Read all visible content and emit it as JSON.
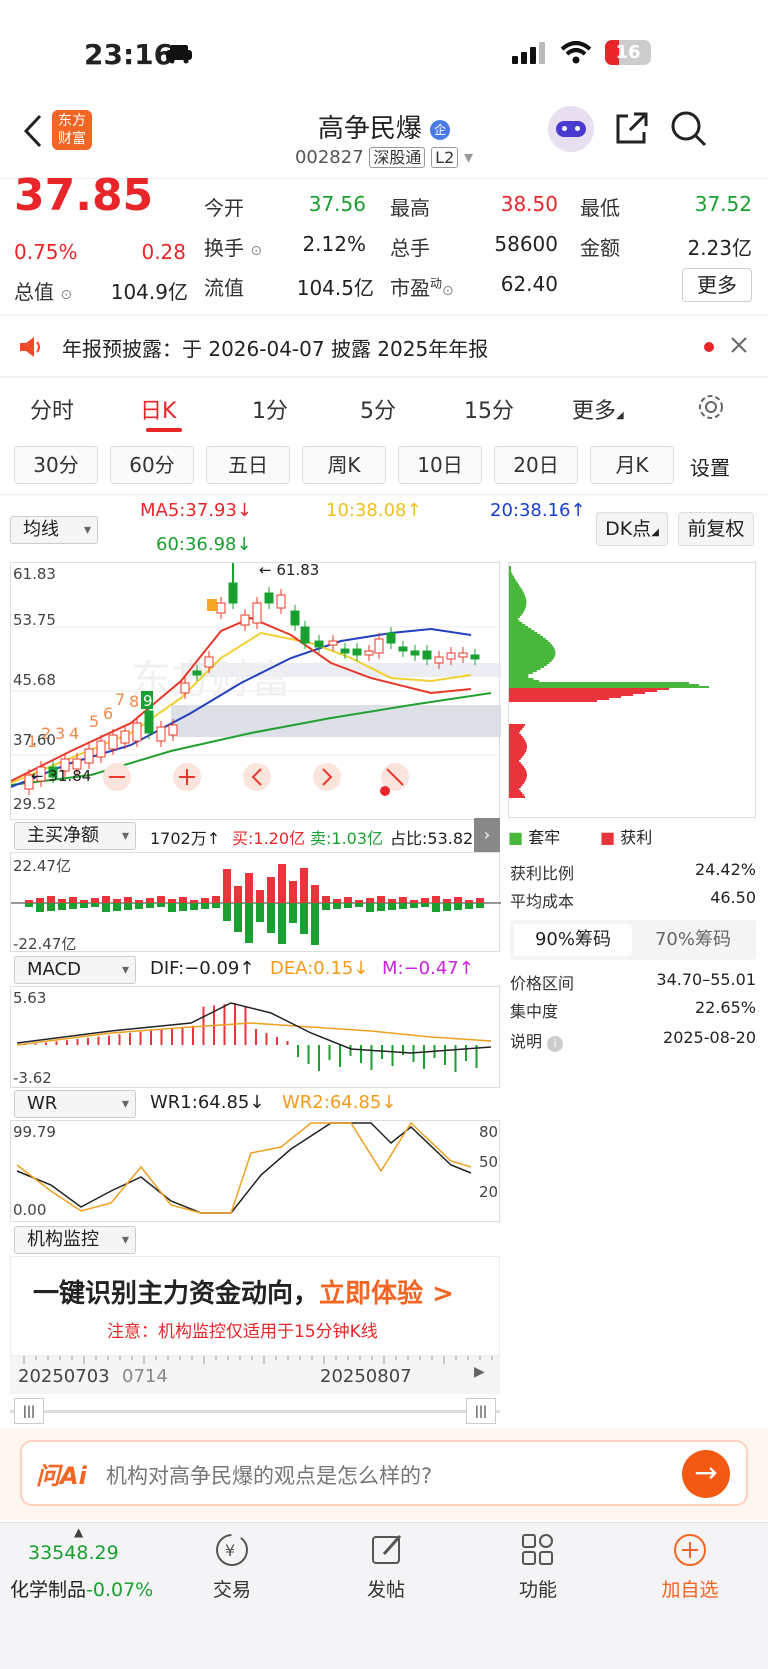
{
  "status": {
    "time": "23:16",
    "battery": "16"
  },
  "header": {
    "title": "高争民爆",
    "code": "002827",
    "tag1": "深股通",
    "tag2": "L2",
    "logo_l1": "东方",
    "logo_l2": "财富"
  },
  "quote": {
    "price": "37.85",
    "change_pct": "0.75%",
    "change": "0.28",
    "open_label": "今开",
    "open": "37.56",
    "high_label": "最高",
    "high": "38.50",
    "low_label": "最低",
    "low": "37.52",
    "turnover_label": "换手",
    "turnover": "2.12%",
    "volume_label": "总手",
    "volume": "58600",
    "amount_label": "金额",
    "amount": "2.23亿",
    "mktcap_label": "总值",
    "mktcap": "104.9亿",
    "float_label": "流值",
    "float": "104.5亿",
    "pe_label": "市盈",
    "pe_sup": "动",
    "pe": "62.40",
    "more_label": "更多"
  },
  "notice": {
    "text": "年报预披露：于 2026-04-07 披露 2025年年报"
  },
  "tabs": [
    "分时",
    "日K",
    "1分",
    "5分",
    "15分",
    "更多"
  ],
  "periods": [
    "30分",
    "60分",
    "五日",
    "周K",
    "10日",
    "20日",
    "月K"
  ],
  "periods_setting": "设置",
  "ma": {
    "selector": "均线",
    "ma5": "MA5:37.93↓",
    "ma10": "10:38.08↑",
    "ma20": "20:38.16↑",
    "ma60": "60:36.98↓",
    "dk": "DK点",
    "adj": "前复权"
  },
  "kchart": {
    "ticks": [
      "61.83",
      "53.75",
      "45.68",
      "37.60",
      "29.52"
    ],
    "high_mark": "61.83",
    "low_mark": "31.84",
    "numbers": [
      "1",
      "2",
      "3",
      "4",
      "5",
      "6",
      "7",
      "8",
      "9"
    ]
  },
  "chip": {
    "legend_hold": "套牢",
    "legend_profit": "获利",
    "colors": {
      "hold": "#48b83c",
      "profit": "#e8343a"
    },
    "profit_ratio_label": "获利比例",
    "profit_ratio": "24.42%",
    "avg_cost_label": "平均成本",
    "avg_cost": "46.50",
    "tab90": "90%筹码",
    "tab70": "70%筹码",
    "range_label": "价格区间",
    "range": "34.70–55.01",
    "conc_label": "集中度",
    "conc": "22.65%",
    "note_label": "说明",
    "note_date": "2025-08-20"
  },
  "flow": {
    "selector": "主买净额",
    "total": "1702万↑",
    "buy": "买:1.20亿",
    "sell": "卖:1.03亿",
    "ratio": "占比:53.82%",
    "top": "22.47亿",
    "bottom": "-22.47亿"
  },
  "macd": {
    "selector": "MACD",
    "dif": "DIF:−0.09↑",
    "dea": "DEA:0.15↓",
    "m": "M:−0.47↑",
    "top": "5.63",
    "bottom": "-3.62"
  },
  "wr": {
    "selector": "WR",
    "wr1": "WR1:64.85↓",
    "wr2": "WR2:64.85↓",
    "top": "99.79",
    "bottom": "0.00",
    "r80": "80",
    "r50": "50",
    "r20": "20"
  },
  "inst": {
    "selector": "机构监控",
    "headline": "一键识别主力资金动向，",
    "cta": "立即体验 >",
    "note": "注意：机构监控仅适用于15分钟K线"
  },
  "timeline": {
    "d1": "20250703",
    "d2": "0714",
    "d3": "20250807"
  },
  "ai": {
    "logo": "问Ai",
    "placeholder": "机构对高争民爆的观点是怎么样的?"
  },
  "bottom": {
    "index_val": "33548.29",
    "index_name": "化学制品",
    "index_chg": "-0.07%",
    "trade": "交易",
    "post": "发帖",
    "func": "功能",
    "add": "加自选"
  }
}
